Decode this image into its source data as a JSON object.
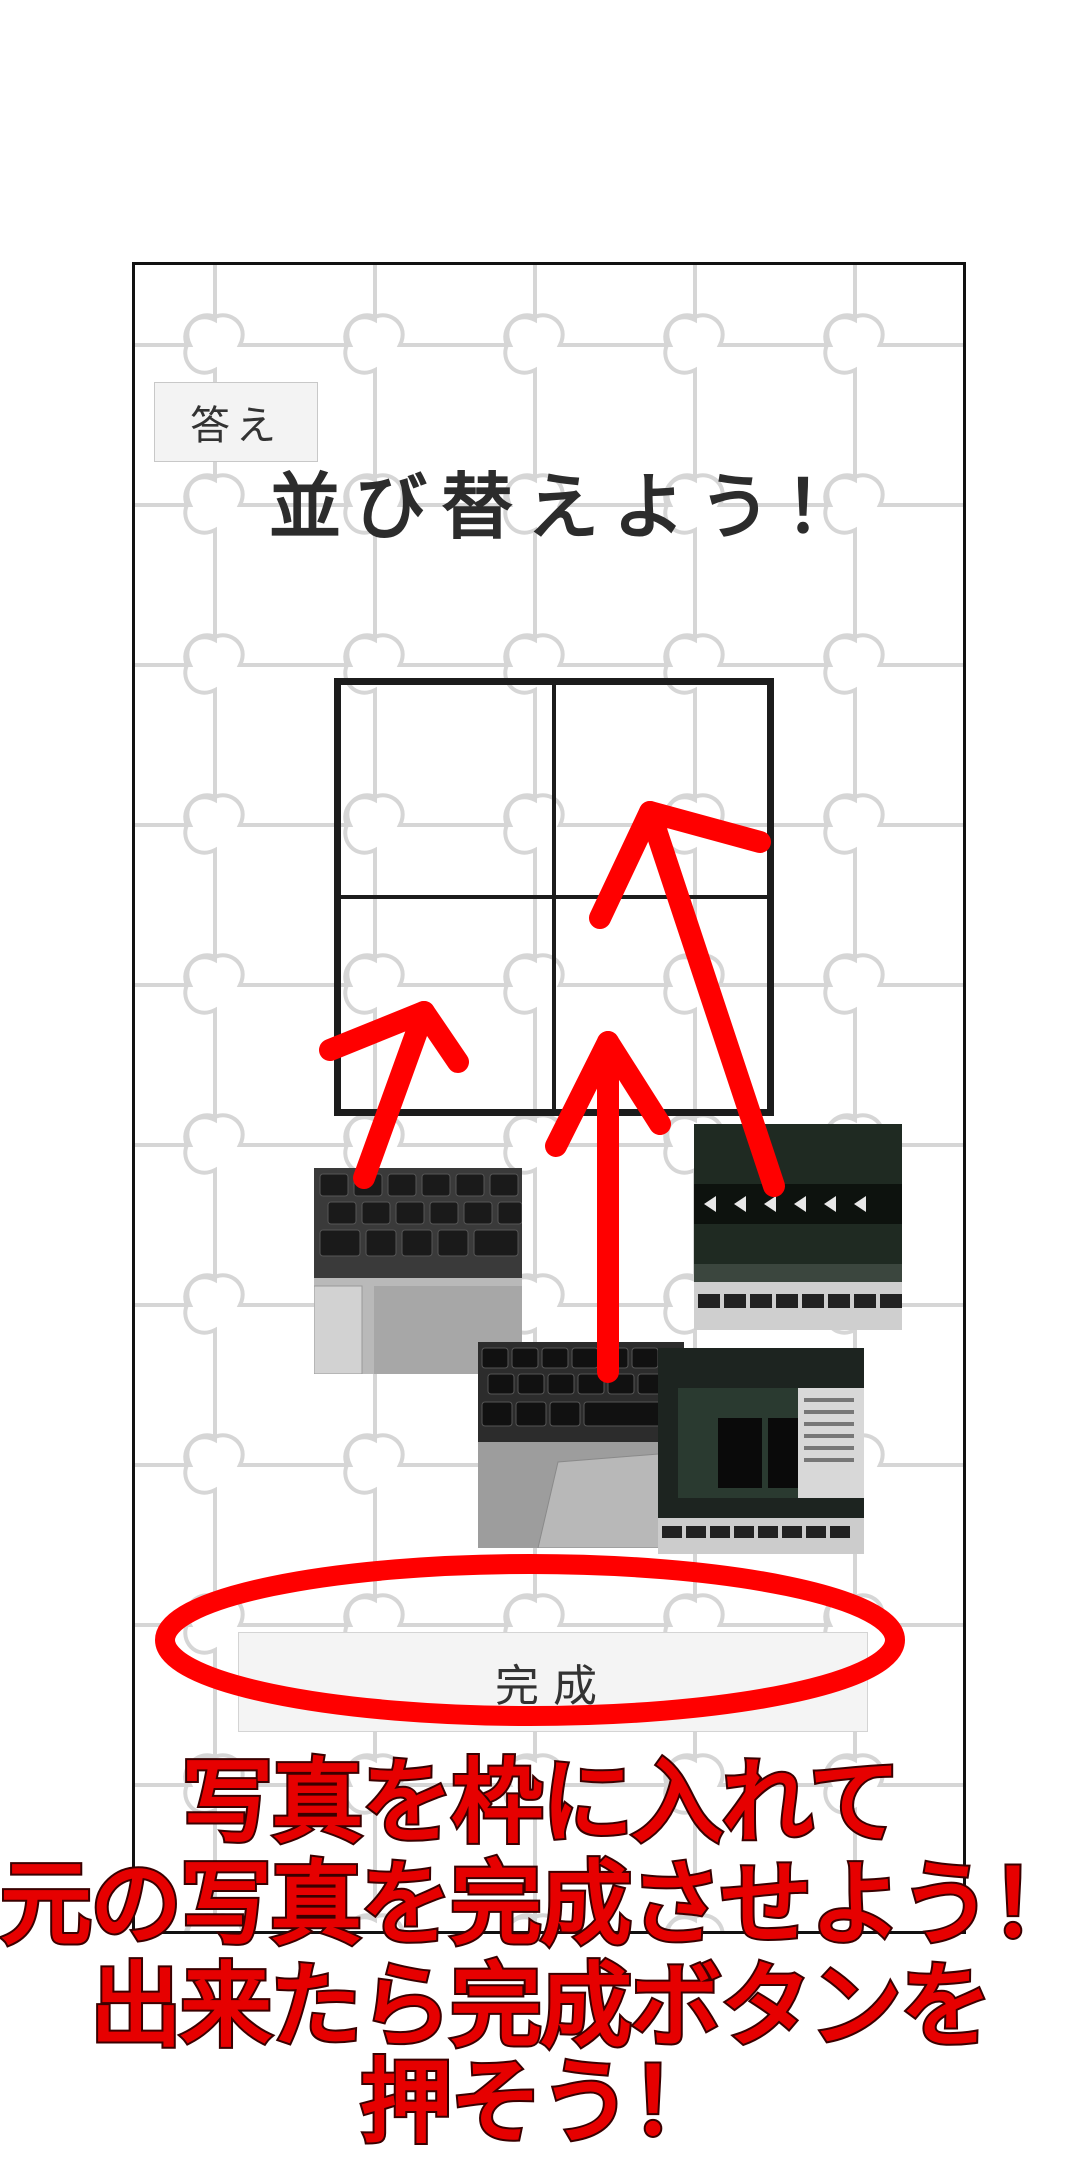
{
  "answer_button": "答え",
  "title": "並び替えよう！",
  "done_button": "完成",
  "caption": {
    "line1": "写真を枠に入れて",
    "line2": "元の写真を完成させよう！",
    "line3": "出来たら完成ボタンを",
    "line4": "押そう！"
  },
  "grid": {
    "rows": 2,
    "cols": 2
  },
  "photos": [
    {
      "name": "keyboard-corner-photo",
      "subject": "laptop keyboard and touchpad"
    },
    {
      "name": "screen-top-photo",
      "subject": "laptop screen showing video editor"
    },
    {
      "name": "keyboard-center-photo",
      "subject": "laptop keyboard center"
    },
    {
      "name": "screen-bottom-photo",
      "subject": "laptop screen with file manager"
    }
  ],
  "colors": {
    "annotation_red": "#ff0000",
    "caption_red": "#e60000",
    "frame": "#111111"
  }
}
